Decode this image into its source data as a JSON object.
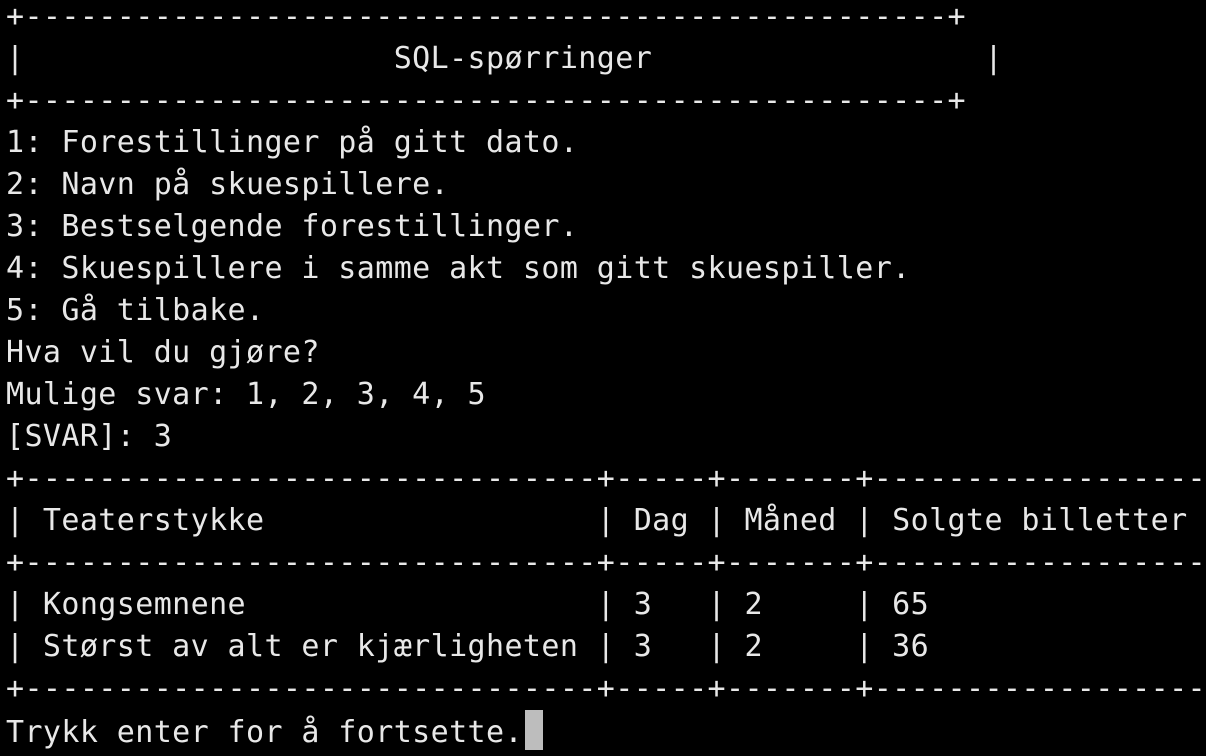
{
  "terminal": {
    "background": "#000000",
    "foreground": "#e8e8e8",
    "cursor_color": "#bdbdbd"
  },
  "header": {
    "border_top": "+--------------------------------------------------+",
    "title_row": "|                    SQL-spørringer                  |",
    "border_bottom": "+--------------------------------------------------+"
  },
  "menu": {
    "items": [
      "1: Forestillinger på gitt dato.",
      "2: Navn på skuespillere.",
      "3: Bestselgende forestillinger.",
      "4: Skuespillere i samme akt som gitt skuespiller.",
      "5: Gå tilbake."
    ],
    "question": "Hva vil du gjøre?",
    "options": "Mulige svar: 1, 2, 3, 4, 5",
    "answer": "[SVAR]: 3"
  },
  "results": {
    "border": "+-------------------------------+-----+-------+------------------+",
    "header_row": "| Teaterstykke                  | Dag | Måned | Solgte billetter |",
    "rows": [
      "| Kongsemnene                   | 3   | 2     | 65               |",
      "| Størst av alt er kjærligheten | 3   | 2     | 36               |"
    ],
    "columns": [
      "Teaterstykke",
      "Dag",
      "Måned",
      "Solgte billetter"
    ],
    "data": [
      [
        "Kongsemnene",
        "3",
        "2",
        "65"
      ],
      [
        "Størst av alt er kjærligheten",
        "3",
        "2",
        "36"
      ]
    ]
  },
  "prompt": {
    "continue_text": "Trykk enter for å fortsette."
  }
}
